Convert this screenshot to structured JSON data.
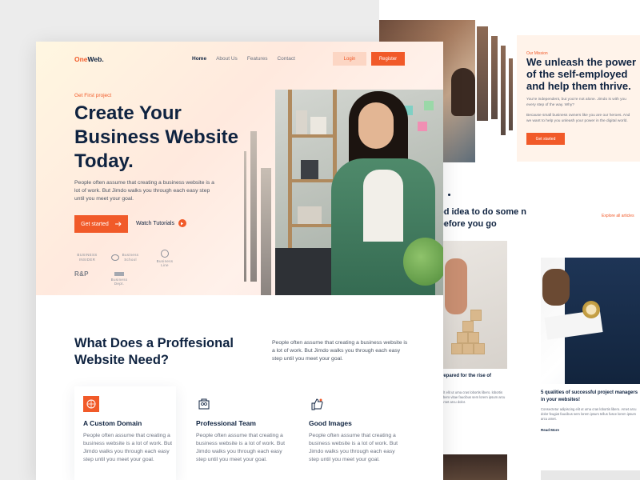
{
  "back": {
    "eyebrow": "Our Mission",
    "title": "We unleash the power of the self-employed and help them thrive.",
    "p1": "You're independent, but you're not alone. Jimdo is with you every step of the way. Why?",
    "p2": "Because small business owners like you are our heroes. And we want to help you unleash your power in the digital world.",
    "started": "Get started",
    "heading": "od idea to do some n before you go",
    "explore": "Explore all articles",
    "card1_title": "repared for the rise of",
    "card1_text": "alt elit ut urna cras lobortis libero. lobortis libero vitae faucibus sem lorem ipsum arcu amet arcu dolor.",
    "card2_title": "5 qualities of successful project managers in your websites!",
    "card2_text": "Consectetur adipiscing elit ut urna cras lobortis libero. Amet arcu dolor feugiat faucibus sem lorem ipsum tellus fusce lorem ipsum arcu amet.",
    "read_more": "Read More"
  },
  "header": {
    "logo_one": "One",
    "logo_web": "Web.",
    "nav": [
      "Home",
      "About Us",
      "Features",
      "Contact"
    ],
    "login": "Login",
    "register": "Register"
  },
  "hero": {
    "eyebrow": "Get First project",
    "title": "Create Your Business Website Today.",
    "description": "People often assume that creating a business website is a lot of work. But Jimdo walks you through each easy step until you meet your goal.",
    "cta": "Get started",
    "watch": "Watch Tutorials"
  },
  "partners": {
    "p1": "BUSINESS INSIDER",
    "p2": "Business School",
    "p3": "Business Line",
    "p4": "R&P",
    "p5": "Business Dept."
  },
  "section": {
    "title": "What Does a Proffesional Website Need?",
    "description": "People often assume that creating a business website is a lot of work. But Jimdo walks you through each easy step until you meet your goal."
  },
  "cards": [
    {
      "title": "A Custom Domain",
      "text": "People often assume that creating a business website is a lot of work. But Jimdo walks you through each easy step until you meet your goal."
    },
    {
      "title": "Professional Team",
      "text": "People often assume that creating a business website is a lot of work. But Jimdo walks you through each easy step until you meet your goal."
    },
    {
      "title": "Good Images",
      "text": "People often assume that creating a business website is a lot of work. But Jimdo walks you through each easy step until you meet your goal."
    }
  ],
  "colors": {
    "accent": "#f15a29",
    "navy": "#0f2340",
    "muted": "#6b7280"
  },
  "icons": [
    "arrow-right-icon",
    "play-icon",
    "domain-icon",
    "team-icon",
    "images-icon"
  ]
}
